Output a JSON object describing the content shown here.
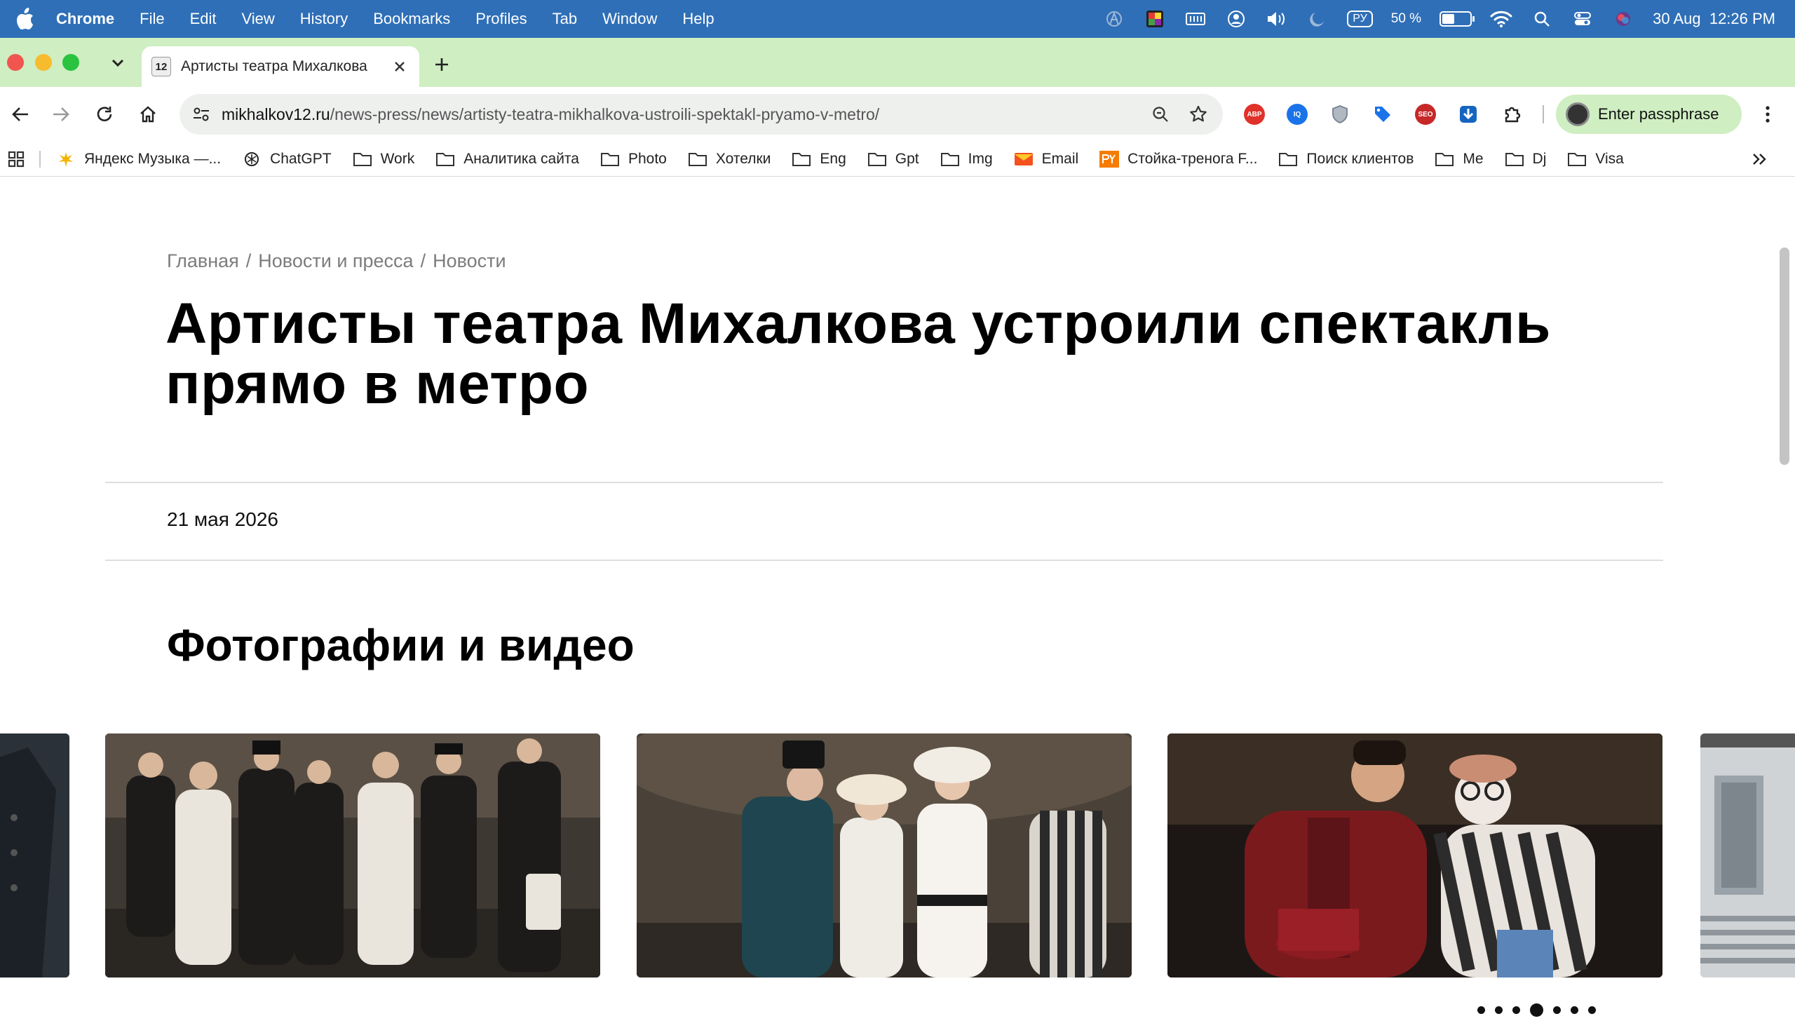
{
  "menubar": {
    "app_name": "Chrome",
    "items": [
      "File",
      "Edit",
      "View",
      "History",
      "Bookmarks",
      "Profiles",
      "Tab",
      "Window",
      "Help"
    ],
    "keyboard_layout": "РУ",
    "battery_text": "50 %",
    "battery_level": 0.5,
    "date": "30 Aug",
    "time": "12:26 PM"
  },
  "tab": {
    "favicon_text": "12",
    "title": "Артисты театра Михалкова"
  },
  "toolbar": {
    "url_host": "mikhalkov12.ru",
    "url_path": "/news-press/news/artisty-teatra-mikhalkova-ustroili-spektakl-pryamo-v-metro/",
    "extensions": [
      {
        "name": "abp",
        "label": "ABP",
        "color": "#e0312b"
      },
      {
        "name": "tracker",
        "label": "IQ",
        "color": "#1a73e8"
      },
      {
        "name": "shield",
        "label": "",
        "color": "#7b8794"
      },
      {
        "name": "tag",
        "label": "",
        "color": "#1a73e8"
      },
      {
        "name": "seo",
        "label": "SEO",
        "color": "#c62828"
      },
      {
        "name": "download",
        "label": "",
        "color": "#1565c0"
      }
    ],
    "profile_chip": "Enter passphrase"
  },
  "bookmarks": [
    {
      "label": "Яндекс Музыка —...",
      "icon": "yandex-music-icon"
    },
    {
      "label": "ChatGPT",
      "icon": "chatgpt-icon"
    },
    {
      "label": "Work",
      "icon": "folder-icon"
    },
    {
      "label": "Аналитика сайта",
      "icon": "folder-icon"
    },
    {
      "label": "Photo",
      "icon": "folder-icon"
    },
    {
      "label": "Хотелки",
      "icon": "folder-icon"
    },
    {
      "label": "Eng",
      "icon": "folder-icon"
    },
    {
      "label": "Gpt",
      "icon": "folder-icon"
    },
    {
      "label": "Img",
      "icon": "folder-icon"
    },
    {
      "label": "Email",
      "icon": "email-icon"
    },
    {
      "label": "Стойка-тренога F...",
      "icon": "py-icon"
    },
    {
      "label": "Поиск клиентов",
      "icon": "folder-icon"
    },
    {
      "label": "Me",
      "icon": "folder-icon"
    },
    {
      "label": "Dj",
      "icon": "folder-icon"
    },
    {
      "label": "Visa",
      "icon": "folder-icon"
    }
  ],
  "page": {
    "breadcrumb": [
      "Главная",
      "Новости и пресса",
      "Новости"
    ],
    "headline_line1": "Артисты театра Михалкова устроили спектакль",
    "headline_line2": "прямо в метро",
    "date": "21 мая 2026",
    "section_title": "Фотографии и видео",
    "carousel": {
      "total_dots": 7,
      "active_index": 3
    }
  }
}
